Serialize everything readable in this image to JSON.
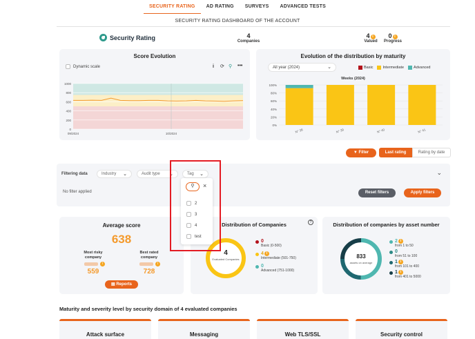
{
  "nav": {
    "items": [
      {
        "label": "SECURITY RATING",
        "active": true
      },
      {
        "label": "AD RATING",
        "active": false
      },
      {
        "label": "SURVEYS",
        "active": false
      },
      {
        "label": "ADVANCED TESTS",
        "active": false
      }
    ]
  },
  "subtitle": "SECURITY RATING DASHBOARD OF THE ACCOUNT",
  "summary": {
    "logo_text": "Security Rating",
    "companies_value": "4",
    "companies_label": "Companies",
    "valued_value": "4",
    "valued_label": "Valued",
    "progress_value": "0",
    "progress_label": "Progress"
  },
  "score_evolution": {
    "title": "Score Evolution",
    "dynamic_scale_label": "Dynamic scale",
    "chart_data": {
      "type": "line",
      "x": [
        "09/2024",
        "10/2024"
      ],
      "ylim": [
        0,
        1000
      ],
      "yticks": [
        "1000",
        "800",
        "600",
        "400",
        "200",
        "0"
      ],
      "series": [
        {
          "values": [
            630,
            630,
            635,
            630,
            680,
            630,
            625,
            625,
            630,
            630,
            620,
            615,
            620,
            630,
            620,
            615,
            610,
            620,
            625
          ]
        }
      ],
      "bands": [
        {
          "from": 750,
          "to": 1000,
          "color": "#cfe8e4"
        },
        {
          "from": 500,
          "to": 750,
          "color": "#fcefc7"
        },
        {
          "from": 0,
          "to": 500,
          "color": "#f4d6d6"
        }
      ]
    }
  },
  "maturity": {
    "title": "Evolution of the distribution by maturity",
    "period": "All year (2024)",
    "legend": [
      {
        "label": "Basic",
        "color": "#b3121b"
      },
      {
        "label": "Intermediate",
        "color": "#fac515"
      },
      {
        "label": "Advanced",
        "color": "#4fb7b0"
      }
    ],
    "weeks_label": "Weeks (2024)",
    "chart_data": {
      "type": "bar",
      "categories": [
        "N° 38",
        "N° 39",
        "N° 40",
        "N° 41"
      ],
      "yticks": [
        "100%",
        "80%",
        "60%",
        "40%",
        "20%",
        "0%"
      ],
      "series": [
        {
          "name": "Basic",
          "values": [
            0,
            0,
            0,
            0
          ]
        },
        {
          "name": "Intermediate",
          "values": [
            92,
            100,
            100,
            100
          ]
        },
        {
          "name": "Advanced",
          "values": [
            8,
            0,
            0,
            0
          ]
        }
      ]
    }
  },
  "controls": {
    "filter_label": "Filter",
    "last_rating_label": "Last rating",
    "rating_by_date_label": "Rating by date"
  },
  "filtering": {
    "label": "Filtering data",
    "industry": "Industry",
    "audit_type": "Audit type",
    "tag": "Tag",
    "no_filter": "No filter applied",
    "reset": "Reset filters",
    "apply": "Apply filters"
  },
  "tag_dropdown": {
    "options": [
      "2",
      "3",
      "4",
      "test"
    ]
  },
  "average_score": {
    "title": "Average score",
    "value": "638",
    "most_risky_label": "Most risky company",
    "most_risky_value": "559",
    "best_rated_label": "Best rated company",
    "best_rated_value": "728",
    "reports_label": "Reports"
  },
  "distribution": {
    "title": "Distribution of Companies",
    "center_value": "4",
    "center_label": "Evaluated Companies",
    "items": [
      {
        "value": "0",
        "label": "Basic (0-500)",
        "color": "#b3121b"
      },
      {
        "value": "4",
        "label": "Intermediate (501-750)",
        "color": "#fac515"
      },
      {
        "value": "0",
        "label": "Advanced (751-1000)",
        "color": "#4fb7b0"
      }
    ]
  },
  "asset_distribution": {
    "title": "Distribution of companies by asset number",
    "center_value": "833",
    "center_label": "assets on average",
    "items": [
      {
        "value": "2",
        "label": "from 1 to 50",
        "color": "#4fb7b0"
      },
      {
        "value": "0",
        "label": "from 51 to 100",
        "color": "#2b8a86"
      },
      {
        "value": "1",
        "label": "from 101 to 400",
        "color": "#1f6870"
      },
      {
        "value": "1",
        "label": "from 401 to 5000",
        "color": "#173e48"
      }
    ]
  },
  "bottom": {
    "title": "Maturity and severity level by security domain of 4 evaluated companies",
    "domains": [
      "Attack surface",
      "Messaging",
      "Web TLS/SSL",
      "Security control"
    ]
  },
  "colors": {
    "accent": "#e8641c",
    "highlight": "#e31b23"
  }
}
